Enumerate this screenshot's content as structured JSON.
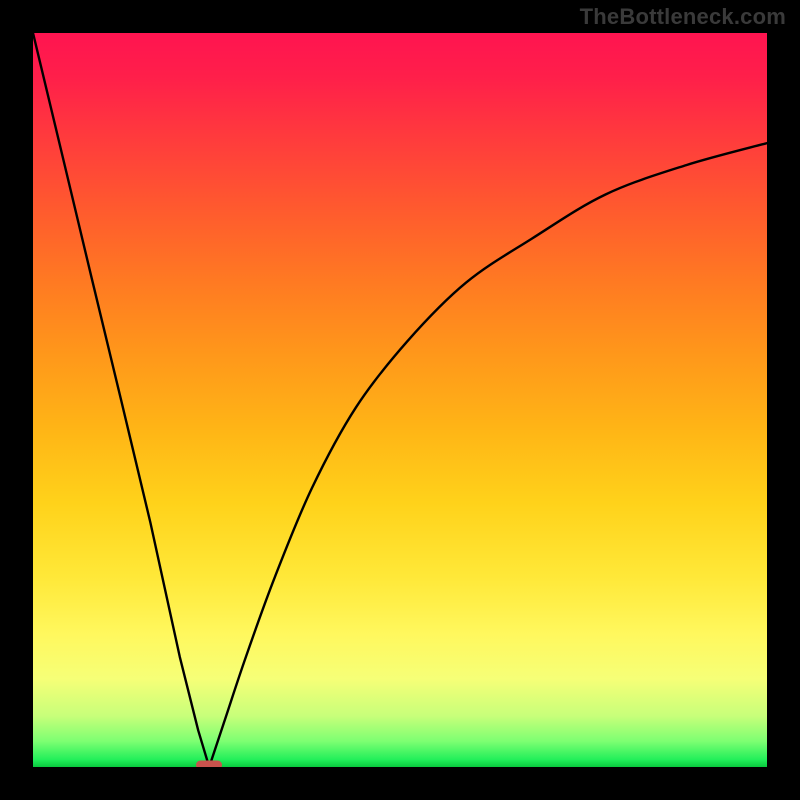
{
  "watermark": "TheBottleneck.com",
  "chart_data": {
    "type": "line",
    "title": "",
    "xlabel": "",
    "ylabel": "",
    "xlim": [
      0,
      1
    ],
    "ylim": [
      0,
      1
    ],
    "notes": "Bottleneck-style V curve on red→green vertical gradient; minimum ≈ x=0.24, y≈0. Left branch is steep/linear from (0,1) to min; right branch rises with diminishing slope toward (1,≈0.85).",
    "series": [
      {
        "name": "left-branch",
        "x": [
          0.0,
          0.04,
          0.08,
          0.12,
          0.16,
          0.2,
          0.225,
          0.24
        ],
        "y": [
          1.0,
          0.833,
          0.666,
          0.5,
          0.333,
          0.15,
          0.05,
          0.0
        ]
      },
      {
        "name": "right-branch",
        "x": [
          0.24,
          0.26,
          0.29,
          0.33,
          0.38,
          0.44,
          0.51,
          0.59,
          0.68,
          0.78,
          0.89,
          1.0
        ],
        "y": [
          0.0,
          0.06,
          0.15,
          0.26,
          0.38,
          0.49,
          0.58,
          0.66,
          0.72,
          0.78,
          0.82,
          0.85
        ]
      }
    ],
    "minimum": {
      "x": 0.24,
      "y": 0.0
    },
    "marker": {
      "shape": "rounded-rect",
      "color": "#c9534d"
    },
    "gradient_stops": [
      {
        "t": 0.0,
        "c": "#ff1450"
      },
      {
        "t": 0.5,
        "c": "#ffb516"
      },
      {
        "t": 0.85,
        "c": "#fff85e"
      },
      {
        "t": 0.97,
        "c": "#7dff72"
      },
      {
        "t": 1.0,
        "c": "#09c93e"
      }
    ]
  }
}
